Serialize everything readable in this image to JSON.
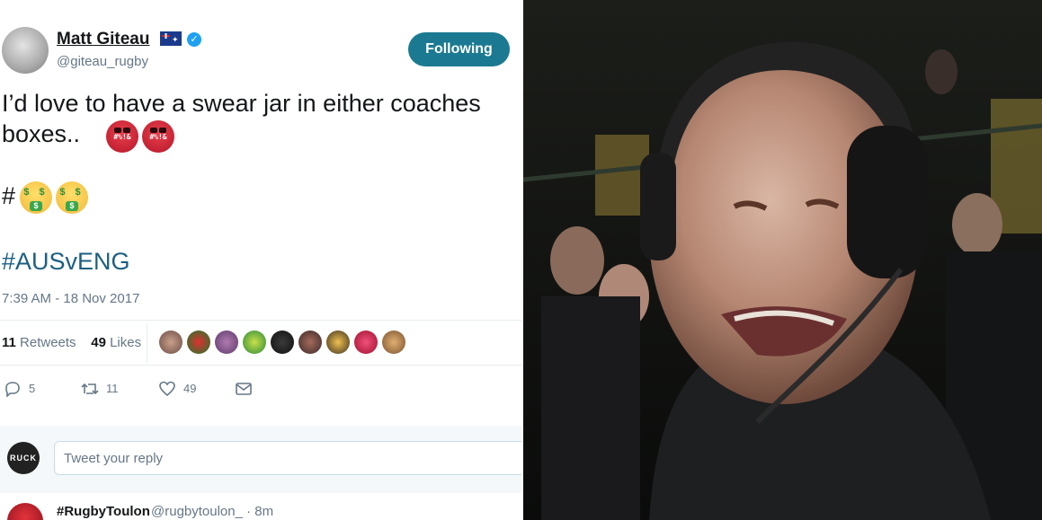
{
  "tweet": {
    "display_name": "Matt Giteau",
    "handle": "@giteau_rugby",
    "follow_label": "Following",
    "text_line1": "I’d love to have a swear jar in either coaches",
    "text_line2": "boxes..",
    "hash_prefix": "#",
    "hashtag": "#AUSvENG",
    "timestamp": "7:39 AM - 18 Nov 2017",
    "retweets_count": "11",
    "retweets_label": "Retweets",
    "likes_count": "49",
    "likes_label": "Likes",
    "reply_count": "5",
    "retweet_action_count": "11",
    "like_action_count": "49"
  },
  "reply": {
    "avatar_text": "RUCK",
    "placeholder": "Tweet your reply"
  },
  "next_tweet": {
    "name": "#RugbyToulon",
    "handle": "@rugbytoulon_ · 8m"
  },
  "emoji": {
    "swear_symbols": "#%!&",
    "money_eyes": "$ $",
    "money_tongue": "$"
  },
  "colors": {
    "follow_button": "#1b7a91",
    "hashtag": "#1b5f82",
    "verified": "#1da1f2",
    "muted": "#657786"
  }
}
